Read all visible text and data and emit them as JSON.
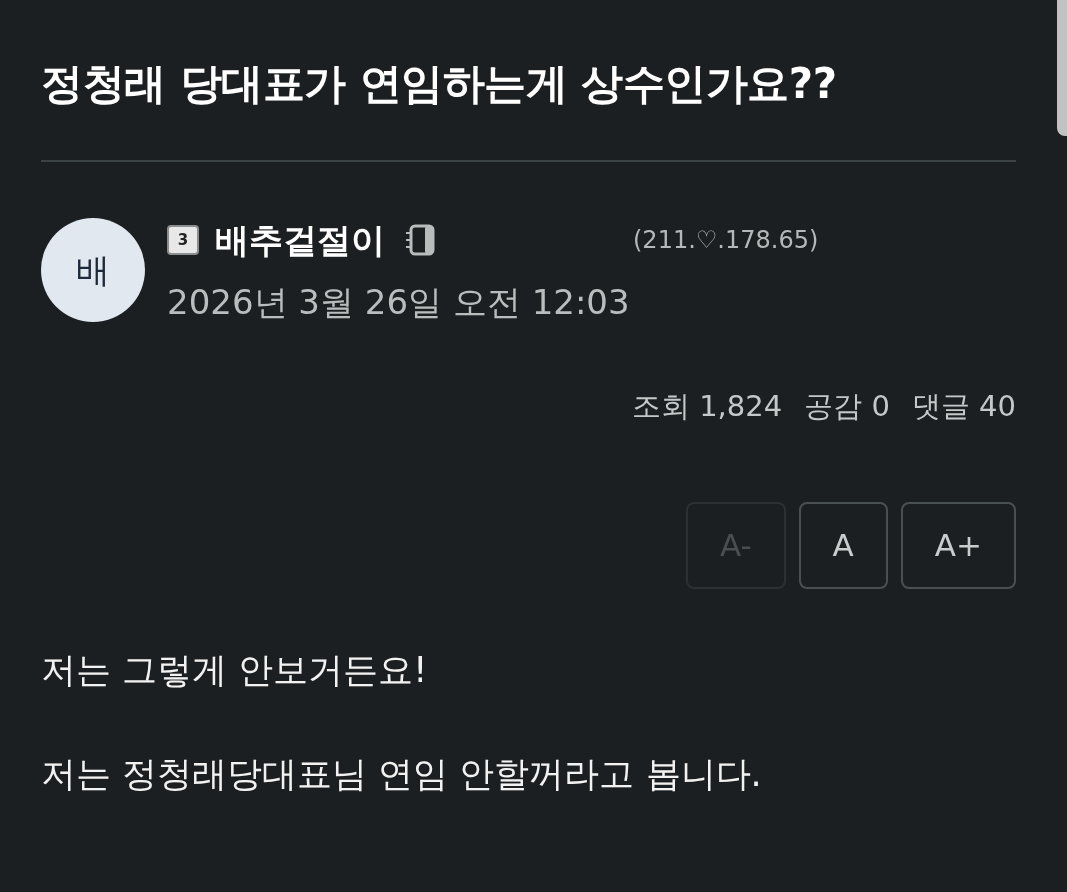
{
  "post": {
    "title": "정청래 당대표가 연임하는게 상수인가요??",
    "author": {
      "avatar_initial": "배",
      "level": "3",
      "name": "배추겉절이",
      "ip": "(211.♡.178.65)",
      "date": "2026년 3월 26일 오전 12:03"
    },
    "stats": [
      "조회 1,824",
      "공감 0",
      "댓글 40"
    ],
    "font_buttons": [
      {
        "label": "A-",
        "disabled": true
      },
      {
        "label": "A",
        "disabled": false
      },
      {
        "label": "A+",
        "disabled": false
      }
    ],
    "body": [
      "저는 그렇게 안보거든요!",
      "저는 정청래당대표님 연임 안할꺼라고 봅니다."
    ]
  }
}
